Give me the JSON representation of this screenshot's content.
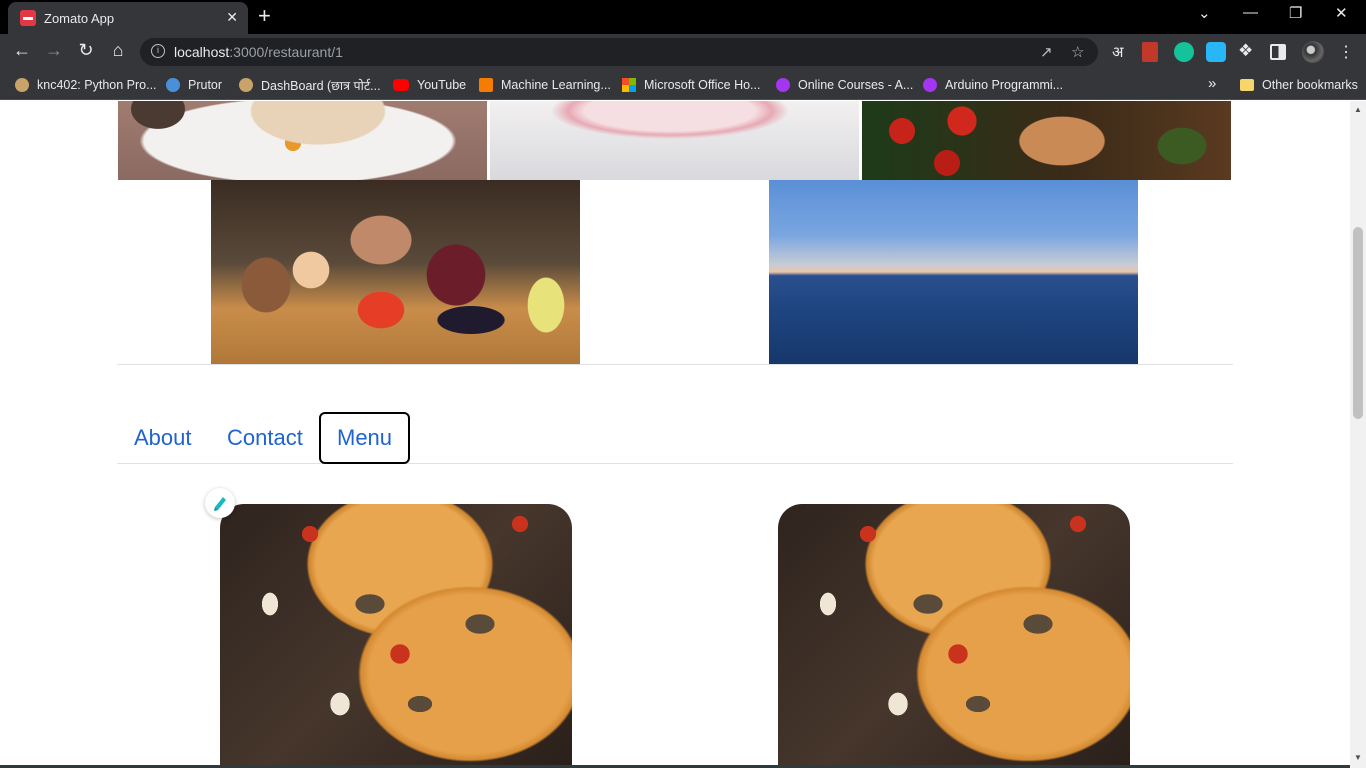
{
  "browser": {
    "tab_title": "Zomato App",
    "tab_close": "✕",
    "new_tab": "+",
    "url_host": "localhost",
    "url_path": ":3000/restaurant/1",
    "window_controls": {
      "collapse": "⌄",
      "minimize": "—",
      "restore": "❐",
      "close": "✕"
    },
    "ext_translate": "अ",
    "menu": "⋮",
    "bookmarks_more": "»",
    "bookmarks": [
      {
        "label": "knc402: Python Pro...",
        "color": "#c9a36a"
      },
      {
        "label": "Prutor",
        "color": "#4a90d9"
      },
      {
        "label": "DashBoard (छात्र पोर्ट...",
        "color": "#c9a36a"
      },
      {
        "label": "YouTube",
        "color": "#ff0000"
      },
      {
        "label": "Machine Learning...",
        "color": "#f57c00"
      },
      {
        "label": "Microsoft Office Ho...",
        "color": "#0078d4"
      },
      {
        "label": "Online Courses - A...",
        "color": "#a435f0"
      },
      {
        "label": "Arduino Programmi...",
        "color": "#a435f0"
      }
    ],
    "other_bookmarks": "Other bookmarks"
  },
  "restaurant": {
    "tabs": [
      {
        "label": "About",
        "active": false
      },
      {
        "label": "Contact",
        "active": false
      },
      {
        "label": "Menu",
        "active": true
      }
    ]
  },
  "colors": {
    "link": "#1f64d0",
    "brand": "#e23744"
  }
}
